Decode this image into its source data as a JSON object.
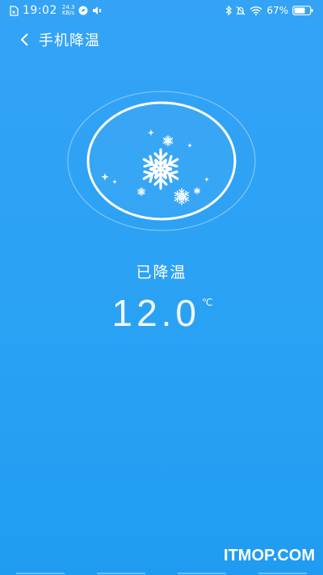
{
  "status_bar": {
    "time": "19:02",
    "net_speed_value": "24.3",
    "net_speed_unit": "KB/s",
    "battery_percent": "67%"
  },
  "header": {
    "title": "手机降温"
  },
  "cooling": {
    "status": "已降温",
    "temperature": "12.0",
    "unit": "℃"
  },
  "watermark": "ITMOP.COM",
  "colors": {
    "background": "#2aa2f4",
    "foreground": "#ffffff"
  }
}
